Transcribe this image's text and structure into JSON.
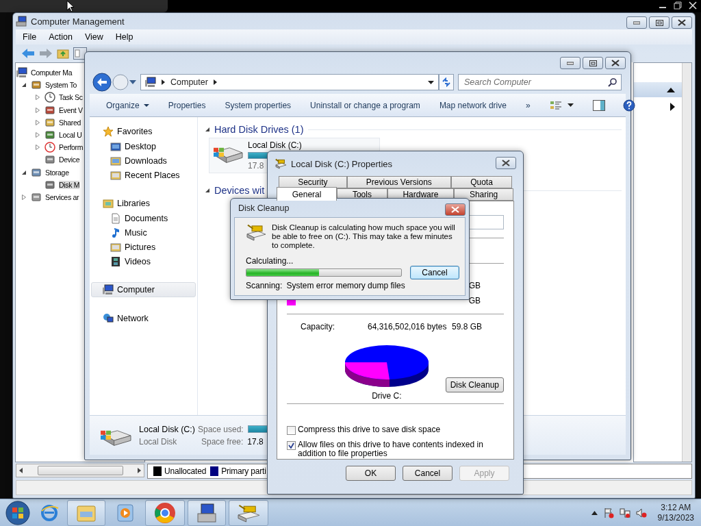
{
  "computer_management": {
    "title": "Computer Management",
    "menu": [
      "File",
      "Action",
      "View",
      "Help"
    ],
    "tree": [
      {
        "label": "Computer Ma",
        "selected": false,
        "children": [
          {
            "label": "System To",
            "selected": false,
            "expanded": true,
            "children": [
              {
                "label": "Task Sc",
                "selected": false,
                "expanded": false
              },
              {
                "label": "Event V",
                "selected": false,
                "expanded": false
              },
              {
                "label": "Shared",
                "selected": false,
                "expanded": false
              },
              {
                "label": "Local U",
                "selected": false,
                "expanded": false
              },
              {
                "label": "Perform",
                "selected": false,
                "expanded": false
              },
              {
                "label": "Device",
                "selected": false
              }
            ]
          },
          {
            "label": "Storage",
            "selected": false,
            "expanded": true,
            "children": [
              {
                "label": "Disk M",
                "selected": true
              }
            ]
          },
          {
            "label": "Services ar",
            "selected": false,
            "expanded": false
          }
        ]
      }
    ],
    "legend": [
      {
        "label": "Unallocated",
        "color": "#000000"
      },
      {
        "label": "Primary parti",
        "color": "#000080"
      }
    ]
  },
  "explorer": {
    "breadcrumb": [
      "Computer"
    ],
    "search": {
      "placeholder": "Search Computer"
    },
    "toolbar": [
      {
        "kind": "menu",
        "label": "Organize"
      },
      {
        "kind": "button",
        "label": "Properties"
      },
      {
        "kind": "button",
        "label": "System properties"
      },
      {
        "kind": "button",
        "label": "Uninstall or change a program"
      },
      {
        "kind": "button",
        "label": "Map network drive"
      },
      {
        "kind": "overflow",
        "label": "»"
      }
    ],
    "nav": [
      {
        "label": "Favorites",
        "selected": false,
        "items": [
          {
            "label": "Desktop",
            "selected": false
          },
          {
            "label": "Downloads",
            "selected": false
          },
          {
            "label": "Recent Places",
            "selected": false
          }
        ]
      },
      {
        "label": "Libraries",
        "selected": false,
        "items": [
          {
            "label": "Documents",
            "selected": false
          },
          {
            "label": "Music",
            "selected": false
          },
          {
            "label": "Pictures",
            "selected": false
          },
          {
            "label": "Videos",
            "selected": false
          }
        ]
      },
      {
        "label": "Computer",
        "selected": true
      },
      {
        "label": "Network",
        "selected": false
      }
    ],
    "groups": [
      {
        "title": "Hard Disk Drives (1)",
        "expanded": true,
        "drives": [
          {
            "name": "Local Disk (C:)",
            "free": "17.8"
          }
        ]
      },
      {
        "title": "Devices wit",
        "expanded": true
      }
    ],
    "details": {
      "name": "Local Disk (C:)",
      "type": "Local Disk",
      "used_label": "Space used:",
      "free_label": "Space free:",
      "free": "17.8"
    }
  },
  "properties": {
    "title": "Local Disk (C:) Properties",
    "tab_rows": [
      {
        "tabs": [
          {
            "label": "Security",
            "selected": false
          },
          {
            "label": "Previous Versions",
            "selected": false
          },
          {
            "label": "Quota",
            "selected": false
          }
        ]
      },
      {
        "tabs": [
          {
            "label": "General",
            "selected": true
          },
          {
            "label": "Tools",
            "selected": false
          },
          {
            "label": "Hardware",
            "selected": false
          },
          {
            "label": "Sharing",
            "selected": false
          }
        ]
      }
    ],
    "space_rows": [
      {
        "size": "GB"
      },
      {
        "size": "GB",
        "color": "#ff00ff"
      }
    ],
    "capacity": {
      "label": "Capacity:",
      "bytes": "64,316,502,016 bytes",
      "size": "59.8 GB"
    },
    "drive_label": "Drive C:",
    "cleanup_button": "Disk Cleanup",
    "options": [
      {
        "label": "Compress this drive to save disk space",
        "checked": false
      },
      {
        "label": "Allow files on this drive to have contents indexed in addition to file properties",
        "checked": true
      }
    ],
    "buttons": [
      {
        "label": "OK",
        "disabled": false
      },
      {
        "label": "Cancel",
        "disabled": false
      },
      {
        "label": "Apply",
        "disabled": true
      }
    ]
  },
  "disk_cleanup": {
    "title": "Disk Cleanup",
    "message": "Disk Cleanup is calculating how much space you will be able to free on  (C:). This may take a few minutes to complete.",
    "status": "Calculating...",
    "level": 0.47,
    "cancel": "Cancel",
    "scanning_label": "Scanning:",
    "scanning_item": "System error memory dump files"
  },
  "taskbar": {
    "apps": [
      {
        "running": false
      },
      {
        "running": true
      },
      {
        "running": false
      },
      {
        "running": true
      },
      {
        "running": true
      },
      {
        "running": true
      }
    ],
    "time": "3:12 AM",
    "date": "9/13/2023"
  }
}
